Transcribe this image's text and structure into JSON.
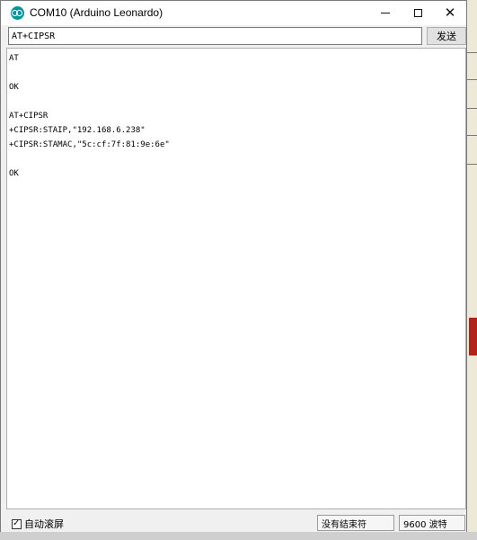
{
  "window": {
    "title": "COM10 (Arduino Leonardo)"
  },
  "input": {
    "value": "AT+CIPSR"
  },
  "toolbar": {
    "send_label": "发送"
  },
  "output": {
    "lines": [
      "AT",
      "",
      "OK",
      "",
      "AT+CIPSR",
      "+CIPSR:STAIP,\"192.168.6.238\"",
      "+CIPSR:STAMAC,\"5c:cf:7f:81:9e:6e\"",
      "",
      "OK"
    ]
  },
  "status": {
    "autoscroll_label": "自动滚屏",
    "autoscroll_checked": true,
    "line_ending": "没有结束符",
    "baud": "9600 波特"
  },
  "icons": {
    "app": "arduino-icon",
    "minimize": "minimize-icon",
    "maximize": "maximize-icon",
    "close": "close-icon"
  },
  "colors": {
    "arduino_teal": "#00979c"
  }
}
